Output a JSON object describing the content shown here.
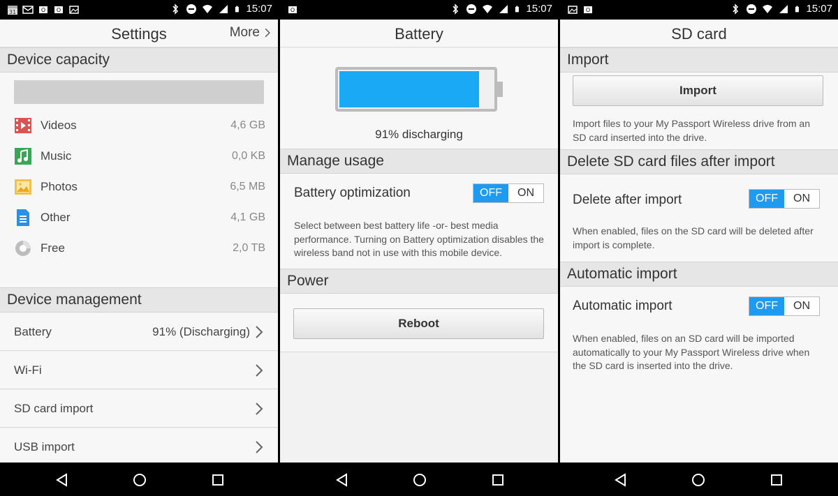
{
  "status": {
    "time": "15:07"
  },
  "settings": {
    "title": "Settings",
    "more_label": "More",
    "device_capacity_header": "Device capacity",
    "capacity": [
      {
        "label": "Videos",
        "value": "4,6 GB",
        "icon": "videos-icon",
        "color": "#d9534f"
      },
      {
        "label": "Music",
        "value": "0,0 KB",
        "icon": "music-icon",
        "color": "#3aa655"
      },
      {
        "label": "Photos",
        "value": "6,5 MB",
        "icon": "photos-icon",
        "color": "#f0c24b"
      },
      {
        "label": "Other",
        "value": "4,1 GB",
        "icon": "document-icon",
        "color": "#2e8fe0"
      },
      {
        "label": "Free",
        "value": "2,0 TB",
        "icon": "free-pie-icon",
        "color": "#bdbdbd"
      }
    ],
    "device_management_header": "Device management",
    "management": [
      {
        "label": "Battery",
        "value": "91% (Discharging)"
      },
      {
        "label": "Wi-Fi",
        "value": ""
      },
      {
        "label": "SD card import",
        "value": ""
      },
      {
        "label": "USB import",
        "value": ""
      }
    ]
  },
  "battery": {
    "title": "Battery",
    "level_fraction": 0.91,
    "status_text": "91% discharging",
    "manage_usage_header": "Manage usage",
    "optimization_label": "Battery optimization",
    "toggle_off": "OFF",
    "toggle_on": "ON",
    "optimization_desc": "Select between best battery life -or- best media performance. Turning on Battery optimization disables the wireless band not in use with this mobile device.",
    "power_header": "Power",
    "reboot_label": "Reboot"
  },
  "sdcard": {
    "title": "SD card",
    "import_header": "Import",
    "import_button": "Import",
    "import_desc": "Import files to your My Passport Wireless drive from an SD card inserted into the drive.",
    "delete_header": "Delete SD card files after import",
    "delete_label": "Delete after import",
    "delete_desc": "When enabled, files on the SD card will be deleted after import is complete.",
    "auto_header": "Automatic import",
    "auto_label": "Automatic import",
    "auto_desc": "When enabled, files on an SD card will be imported automatically to your My Passport Wireless drive when the SD card is inserted into the drive.",
    "toggle_off": "OFF",
    "toggle_on": "ON"
  },
  "colors": {
    "accent": "#1e9bf0",
    "battery_fill": "#1aa9f5"
  }
}
